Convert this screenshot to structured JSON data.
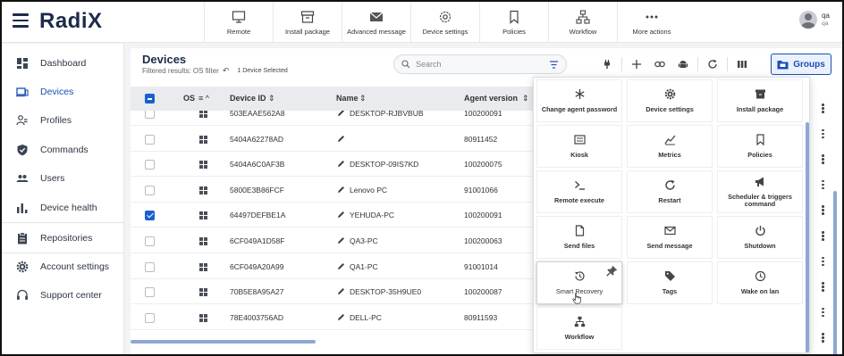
{
  "app": {
    "logo": "RadiX"
  },
  "toolbar": {
    "items": [
      {
        "label": "Remote",
        "icon": "monitor-icon"
      },
      {
        "label": "Install package",
        "icon": "archive-icon"
      },
      {
        "label": "Advanced message",
        "icon": "envelope-icon"
      },
      {
        "label": "Device settings",
        "icon": "gear-icon"
      },
      {
        "label": "Policies",
        "icon": "bookmark-icon"
      },
      {
        "label": "Workflow",
        "icon": "workflow-icon"
      },
      {
        "label": "More actions",
        "icon": "more-dots-icon"
      }
    ]
  },
  "user": {
    "name": "qa",
    "sub": "qa"
  },
  "sidebar": {
    "items": [
      {
        "label": "Dashboard",
        "icon": "dashboard-icon"
      },
      {
        "label": "Devices",
        "icon": "devices-icon",
        "active": true
      },
      {
        "label": "Profiles",
        "icon": "profiles-icon"
      },
      {
        "label": "Commands",
        "icon": "shield-icon"
      },
      {
        "label": "Users",
        "icon": "users-icon"
      },
      {
        "label": "Device health",
        "icon": "bar-chart-icon"
      },
      {
        "label": "Repositories",
        "icon": "clipboard-icon"
      },
      {
        "label": "Account settings",
        "icon": "gear-icon"
      },
      {
        "label": "Support center",
        "icon": "headset-icon"
      }
    ]
  },
  "devices": {
    "title": "Devices",
    "filter_text": "Filtered results: OS filter",
    "selected_text": "1 Device Selected",
    "search_placeholder": "Search",
    "groups_label": "Groups",
    "columns": {
      "os": "OS",
      "device_id": "Device ID",
      "name": "Name",
      "agent_version": "Agent version"
    },
    "rows": [
      {
        "id": "503EAAE562A8",
        "name": "DESKTOP-RJBVBUB",
        "agent": "100200091",
        "checked": false
      },
      {
        "id": "5404A62278AD",
        "name": "",
        "agent": "80911452",
        "checked": false
      },
      {
        "id": "5404A6C0AF3B",
        "name": "DESKTOP-09IS7KD",
        "agent": "100200075",
        "checked": false
      },
      {
        "id": "5800E3B86FCF",
        "name": "Lenovo PC",
        "agent": "91001066",
        "checked": false
      },
      {
        "id": "64497DEFBE1A",
        "name": "YEHUDA-PC",
        "agent": "100200091",
        "checked": true
      },
      {
        "id": "6CF049A1D58F",
        "name": "QA3-PC",
        "agent": "100200063",
        "checked": false
      },
      {
        "id": "6CF049A20A99",
        "name": "QA1-PC",
        "agent": "91001014",
        "checked": false
      },
      {
        "id": "70B5E8A95A27",
        "name": "DESKTOP-35H9UE0",
        "agent": "100200087",
        "checked": false
      },
      {
        "id": "78E4003756AD",
        "name": "DELL-PC",
        "agent": "80911593",
        "checked": false
      }
    ]
  },
  "commands": [
    {
      "label": "Change agent password",
      "icon": "asterisk-icon"
    },
    {
      "label": "Device settings",
      "icon": "gear-icon"
    },
    {
      "label": "Install package",
      "icon": "archive-icon"
    },
    {
      "label": "Kiosk",
      "icon": "kiosk-icon"
    },
    {
      "label": "Metrics",
      "icon": "metrics-icon"
    },
    {
      "label": "Policies",
      "icon": "bookmark-icon"
    },
    {
      "label": "Remote execute",
      "icon": "terminal-icon"
    },
    {
      "label": "Restart",
      "icon": "restart-icon"
    },
    {
      "label": "Scheduler & triggers command",
      "icon": "megaphone-icon"
    },
    {
      "label": "Send files",
      "icon": "file-icon"
    },
    {
      "label": "Send message",
      "icon": "envelope-icon"
    },
    {
      "label": "Shutdown",
      "icon": "power-icon"
    },
    {
      "label": "Smart Recovery",
      "icon": "history-icon",
      "hovered": true
    },
    {
      "label": "Tags",
      "icon": "tag-icon"
    },
    {
      "label": "Wake on lan",
      "icon": "clock-icon"
    },
    {
      "label": "Workflow",
      "icon": "workflow-icon"
    }
  ]
}
